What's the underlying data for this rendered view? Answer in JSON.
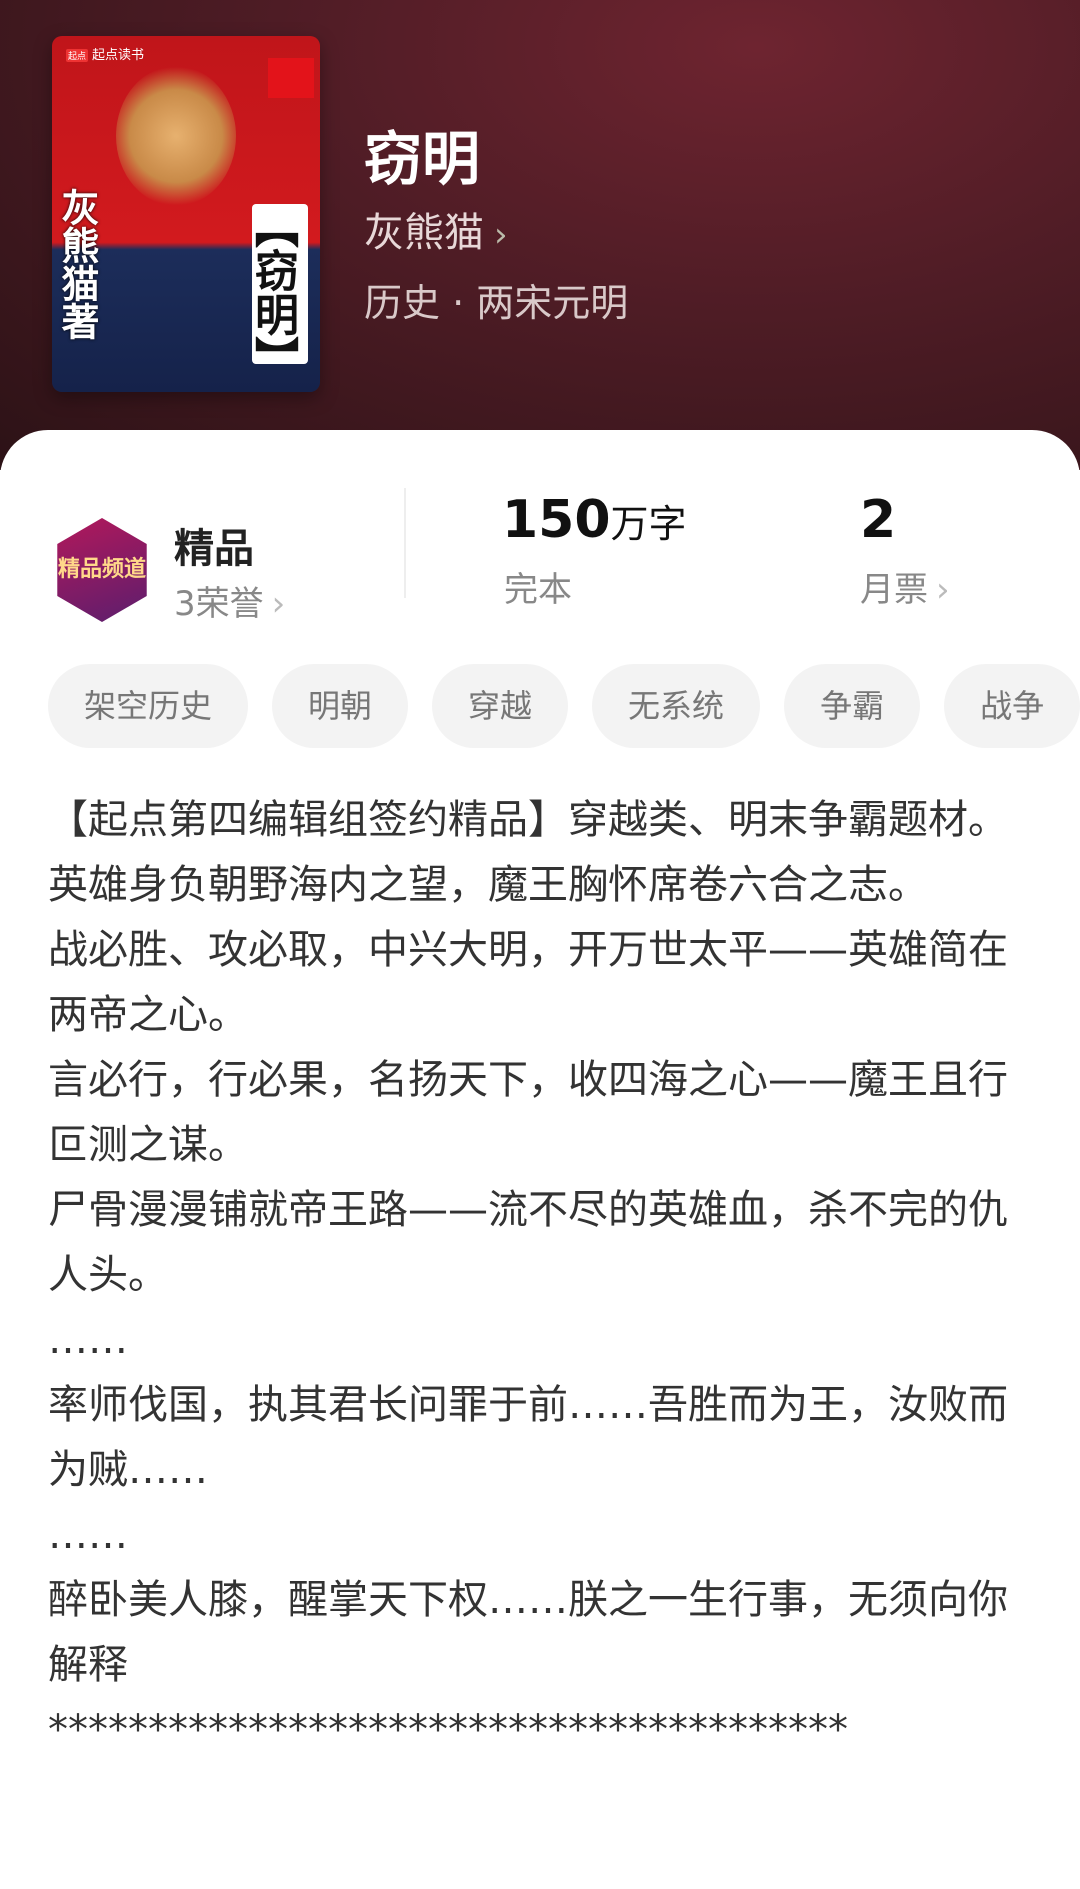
{
  "book": {
    "cover": {
      "publisher": "起点读书",
      "publisher_badge": "起点",
      "author_text": "灰熊猫著",
      "title_text": "【窃明】"
    },
    "title": "窃明",
    "author": "灰熊猫",
    "category": "历史 · 两宋元明"
  },
  "honor": {
    "badge_text": "精品频道",
    "title": "精品",
    "subtitle": "3荣誉"
  },
  "stats": {
    "words_number": "150",
    "words_unit": "万字",
    "words_label": "完本",
    "votes_number": "2",
    "votes_label": "月票"
  },
  "tags": [
    "架空历史",
    "明朝",
    "穿越",
    "无系统",
    "争霸",
    "战争"
  ],
  "description": "【起点第四编辑组签约精品】穿越类、明末争霸题材。\n英雄身负朝野海内之望，魔王胸怀席卷六合之志。\n战必胜、攻必取，中兴大明，开万世太平——英雄简在两帝之心。\n言必行，行必果，名扬天下，收四海之心——魔王且行叵测之谋。\n尸骨漫漫铺就帝王路——流不尽的英雄血，杀不完的仇人头。\n……\n率师伐国，执其君长问罪于前……吾胜而为王，汝败而为贼……\n……\n醉卧美人膝，醒掌天下权……朕之一生行事，无须向你解释\n****************************************",
  "icons": {
    "author_chevron": "chevron-right-icon",
    "honor_chevron": "chevron-right-icon",
    "votes_chevron": "chevron-right-icon"
  }
}
